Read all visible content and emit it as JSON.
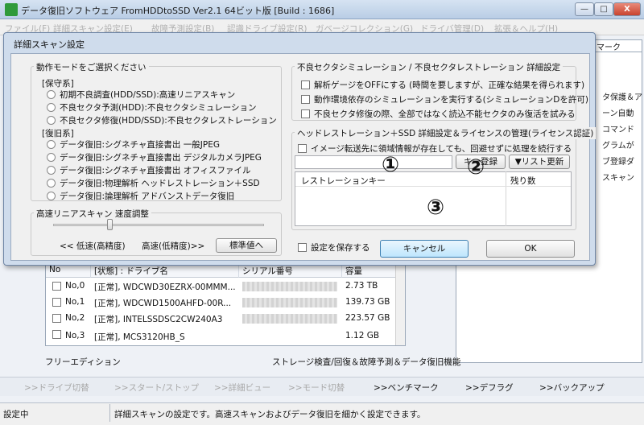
{
  "window": {
    "title": "データ復旧ソフトウェア FromHDDtoSSD Ver2.1 64ビット版 [Build : 1686]",
    "controls": [
      "—",
      "□",
      "X"
    ]
  },
  "menu": [
    "ファイル(F)",
    "詳細スキャン設定(E)",
    "故障予測設定(B)",
    "認識ドライブ設定(R)",
    "ガベージコレクション(G)",
    "ドライバ管理(D)",
    "拡張＆ヘルプ(H)"
  ],
  "right_panel": {
    "tab": "マーク",
    "lines": [
      "タ保護＆ア",
      "ーン自動",
      "コマンド",
      "グラムが",
      "ブ登録ダ",
      "スキャン"
    ]
  },
  "drive_table": {
    "columns": [
      "No",
      "[状態] : ドライブ名",
      "シリアル番号",
      "容量"
    ],
    "rows": [
      {
        "no": "No,0",
        "drive": "[正常], WDCWD30EZRX-00MMM...",
        "capacity": "2.73 TB"
      },
      {
        "no": "No,1",
        "drive": "[正常], WDCWD1500AHFD-00R...",
        "capacity": "139.73 GB"
      },
      {
        "no": "No,2",
        "drive": "[正常], INTELSSDSC2CW240A3",
        "capacity": "223.57 GB"
      },
      {
        "no": "No,3",
        "drive": "[正常], MCS3120HB_S",
        "capacity": "1.12 GB"
      }
    ]
  },
  "edition": "フリーエディション",
  "features": "ストレージ検査/回復＆故障予測＆データ復旧機能",
  "nav": [
    {
      "label": ">>ドライブ切替",
      "enabled": false
    },
    {
      "label": ">>スタート/ストップ",
      "enabled": false
    },
    {
      "label": ">>詳細ビュー",
      "enabled": false
    },
    {
      "label": ">>モード切替",
      "enabled": false
    },
    {
      "label": ">>ベンチマーク",
      "enabled": true
    },
    {
      "label": ">>デフラグ",
      "enabled": true
    },
    {
      "label": ">>バックアップ",
      "enabled": true
    }
  ],
  "status": {
    "left": "設定中",
    "message": "詳細スキャンの設定です。高速スキャンおよびデータ復旧を細かく設定できます。"
  },
  "dialog": {
    "title": "詳細スキャン設定",
    "mode_group": {
      "label": "動作モードをご選択ください",
      "sections": [
        {
          "heading": "[保守系]",
          "options": [
            "初期不良調査(HDD/SSD):高速リニアスキャン",
            "不良セクタ予測(HDD):不良セクタシミュレーション",
            "不良セクタ修復(HDD/SSD):不良セクタレストレーション"
          ]
        },
        {
          "heading": "[復旧系]",
          "options": [
            "データ復旧:シグネチャ直接書出 一般JPEG",
            "データ復旧:シグネチャ直接書出 デジタルカメラJPEG",
            "データ復旧:シグネチャ直接書出 オフィスファイル",
            "データ復旧:物理解析 ヘッドレストレーション＋SSD",
            "データ復旧:論理解析 アドバンストデータ復旧"
          ]
        }
      ]
    },
    "speed_group": {
      "label": "高速リニアスキャン 速度調整",
      "slider_value": 0.27,
      "low_label": "<< 低速(高精度)",
      "high_label": "高速(低精度)>>",
      "default_button": "標準値へ"
    },
    "sim_group": {
      "label": "不良セクタシミュレーション / 不良セクタレストレーション 詳細設定",
      "options": [
        "解析ゲージをOFFにする (時間を要しますが、正確な結果を得られます)",
        "動作環境依存のシミュレーションを実行する(シミュレーションDを許可)",
        "不良セクタ修復の際、全部ではなく読込不能セクタのみ復活を試みる"
      ]
    },
    "head_group": {
      "label": "ヘッドレストレーション＋SSD 詳細設定＆ライセンスの管理(ライセンス認証)",
      "option": "イメージ転送先に領域情報が存在しても、回避せずに処理を続行する",
      "key_register_button": "キー登録",
      "list_update_button": "▼リスト更新",
      "columns": [
        "レストレーションキー",
        "残り数"
      ]
    },
    "save_settings": "設定を保存する",
    "cancel_button": "キャンセル",
    "ok_button": "OK"
  },
  "markers": [
    "①",
    "②",
    "③"
  ]
}
